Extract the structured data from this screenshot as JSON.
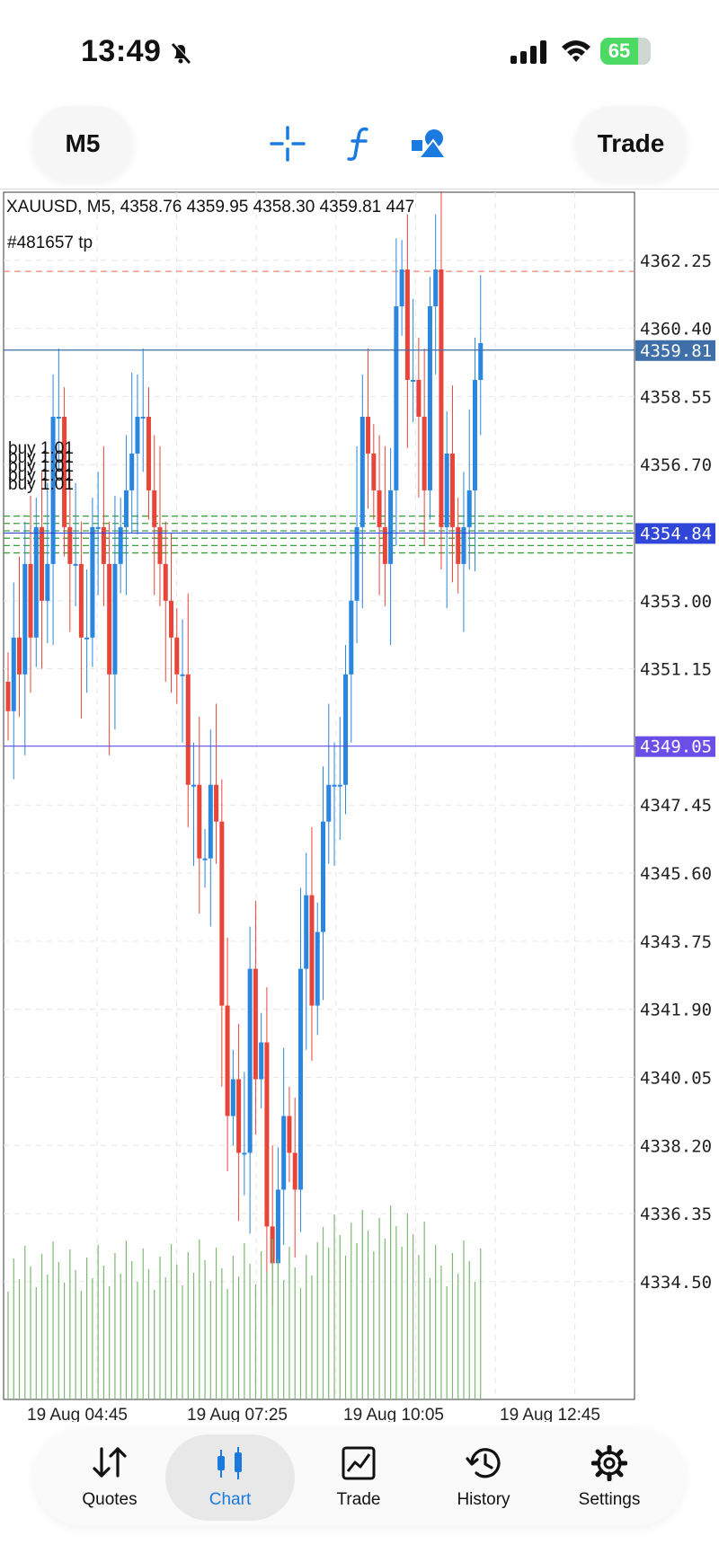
{
  "status_bar": {
    "time": "13:49",
    "battery": "65"
  },
  "toolbar": {
    "timeframe": "M5",
    "trade_label": "Trade",
    "icons": [
      "crosshair-icon",
      "indicators-icon",
      "objects-icon"
    ]
  },
  "chart": {
    "header": "XAUUSD, M5, 4358.76 4359.95 4358.30 4359.81 447",
    "order_ticket": "#481657 tp",
    "order_label": "buy 1.01",
    "colors": {
      "bull": "#2a86de",
      "bear": "#e8453a",
      "volume": "#7cb872",
      "order": "#3aa03a",
      "price_line": "#3e6fa8",
      "blue_line": "#2f46d8",
      "purple_line": "#5b4ee3"
    }
  },
  "chart_data": {
    "type": "candlestick",
    "symbol": "XAUUSD",
    "timeframe": "M5",
    "last": {
      "open": 4358.76,
      "high": 4359.95,
      "low": 4358.3,
      "close": 4359.81,
      "volume": 447
    },
    "y_ticks": [
      "4362.25",
      "4360.40",
      "4358.55",
      "4356.70",
      "4353.00",
      "4351.15",
      "4347.45",
      "4345.60",
      "4343.75",
      "4341.90",
      "4340.05",
      "4338.20",
      "4336.35",
      "4334.50"
    ],
    "x_ticks": [
      "19 Aug 04:45",
      "19 Aug 07:25",
      "19 Aug 10:05",
      "19 Aug 12:45"
    ],
    "ylim": [
      4331.3,
      4364.1
    ],
    "price_tags": [
      "4359.81",
      "4354.84",
      "4349.05"
    ],
    "take_profit": 4361.95,
    "order_levels": [
      4355.3,
      4355.1,
      4354.9,
      4354.7,
      4354.5,
      4354.3
    ],
    "close": [
      4350,
      4352,
      4351,
      4354,
      4352,
      4355,
      4353,
      4354,
      4358,
      4358,
      4355,
      4354,
      4354,
      4352,
      4352,
      4355,
      4355,
      4354,
      4351,
      4354,
      4355,
      4356,
      4357,
      4358,
      4358,
      4356,
      4355,
      4354,
      4353,
      4352,
      4351,
      4351,
      4348,
      4348,
      4346,
      4346,
      4348,
      4347,
      4342,
      4339,
      4340,
      4338,
      4338,
      4343,
      4340,
      4341,
      4336,
      4335,
      4337,
      4339,
      4338,
      4337,
      4343,
      4345,
      4342,
      4344,
      4347,
      4348,
      4348,
      4348,
      4351,
      4353,
      4355,
      4358,
      4357,
      4356,
      4355,
      4354,
      4356,
      4361,
      4362,
      4359,
      4359,
      4358,
      4356,
      4361,
      4362,
      4355,
      4357,
      4355,
      4354,
      4355,
      4356,
      4359,
      4360
    ]
  },
  "nav": {
    "tabs": [
      {
        "label": "Quotes",
        "icon": "quotes-icon"
      },
      {
        "label": "Chart",
        "icon": "chart-icon"
      },
      {
        "label": "Trade",
        "icon": "trade-icon"
      },
      {
        "label": "History",
        "icon": "history-icon"
      },
      {
        "label": "Settings",
        "icon": "settings-icon"
      }
    ],
    "active": "Chart"
  }
}
